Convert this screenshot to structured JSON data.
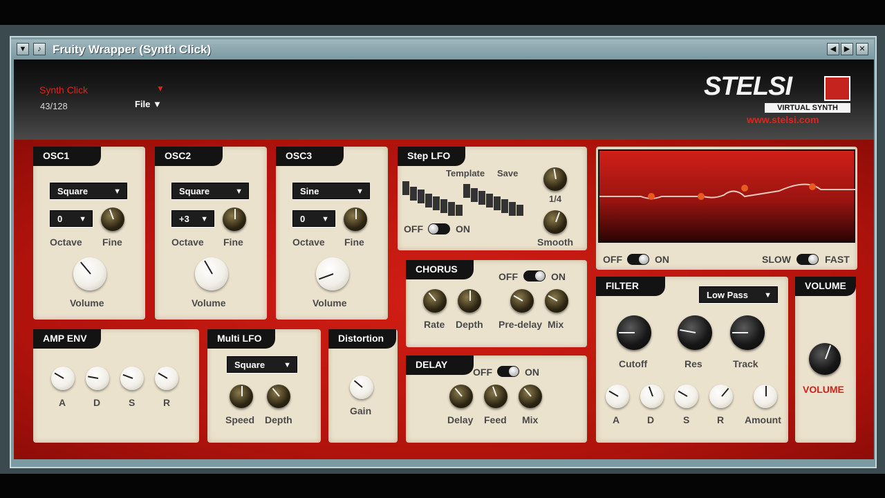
{
  "window": {
    "title": "Fruity Wrapper (Synth Click)"
  },
  "header": {
    "patch_name": "Synth Click",
    "patch_count": "43/128",
    "file_menu": "File"
  },
  "logo": {
    "main": "STELSI",
    "sub": "VIRTUAL SYNTH",
    "url": "www.stelsi.com"
  },
  "osc1": {
    "title": "OSC1",
    "wave": "Square",
    "octave_val": "0",
    "octave": "Octave",
    "fine": "Fine",
    "volume": "Volume"
  },
  "osc2": {
    "title": "OSC2",
    "wave": "Square",
    "octave_val": "+3",
    "octave": "Octave",
    "fine": "Fine",
    "volume": "Volume"
  },
  "osc3": {
    "title": "OSC3",
    "wave": "Sine",
    "octave_val": "0",
    "octave": "Octave",
    "fine": "Fine",
    "volume": "Volume"
  },
  "step_lfo": {
    "title": "Step LFO",
    "template": "Template",
    "save": "Save",
    "off": "OFF",
    "on": "ON",
    "rate": "1/4",
    "smooth": "Smooth"
  },
  "lfo_display": {
    "off": "OFF",
    "on": "ON",
    "slow": "SLOW",
    "fast": "FAST"
  },
  "chorus": {
    "title": "CHORUS",
    "off": "OFF",
    "on": "ON",
    "rate": "Rate",
    "depth": "Depth",
    "predelay": "Pre-delay",
    "mix": "Mix"
  },
  "delay": {
    "title": "DELAY",
    "off": "OFF",
    "on": "ON",
    "delay": "Delay",
    "feed": "Feed",
    "mix": "Mix"
  },
  "filter": {
    "title": "FILTER",
    "type": "Low Pass",
    "cutoff": "Cutoff",
    "res": "Res",
    "track": "Track",
    "a": "A",
    "d": "D",
    "s": "S",
    "r": "R",
    "amount": "Amount"
  },
  "volume": {
    "title": "VOLUME",
    "label": "VOLUME"
  },
  "amp_env": {
    "title": "AMP ENV",
    "a": "A",
    "d": "D",
    "s": "S",
    "r": "R"
  },
  "multi_lfo": {
    "title": "Multi LFO",
    "wave": "Square",
    "speed": "Speed",
    "depth": "Depth"
  },
  "distortion": {
    "title": "Distortion",
    "gain": "Gain"
  },
  "colors": {
    "accent_red": "#d21e14",
    "panel": "#ebe2cd",
    "titlebar": "#7c9aa2"
  }
}
